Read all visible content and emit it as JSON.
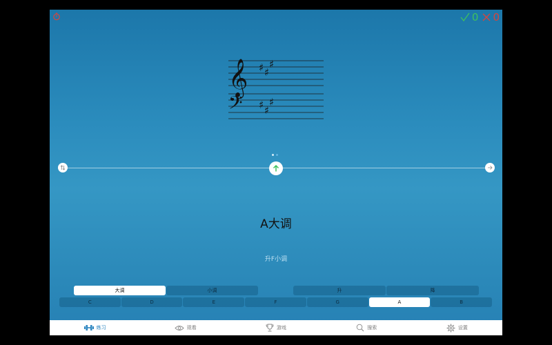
{
  "stats": {
    "correct": "0",
    "wrong": "0"
  },
  "key": {
    "name": "A大调",
    "relative": "升F小调"
  },
  "mode_segment": {
    "options": [
      "大调",
      "小调"
    ],
    "selected": "大调"
  },
  "accidental_segment": {
    "options": [
      "升",
      "降"
    ]
  },
  "note_segment": {
    "options": [
      "C",
      "D",
      "E",
      "F",
      "G",
      "A",
      "B"
    ],
    "selected": "A"
  },
  "tabbar": {
    "items": [
      "练习",
      "观看",
      "游戏",
      "搜索",
      "设置"
    ],
    "active": "练习"
  },
  "colors": {
    "accent": "#2c86c0",
    "correct": "#3ec15e",
    "wrong": "#d8443c",
    "timer": "#d8443c"
  }
}
